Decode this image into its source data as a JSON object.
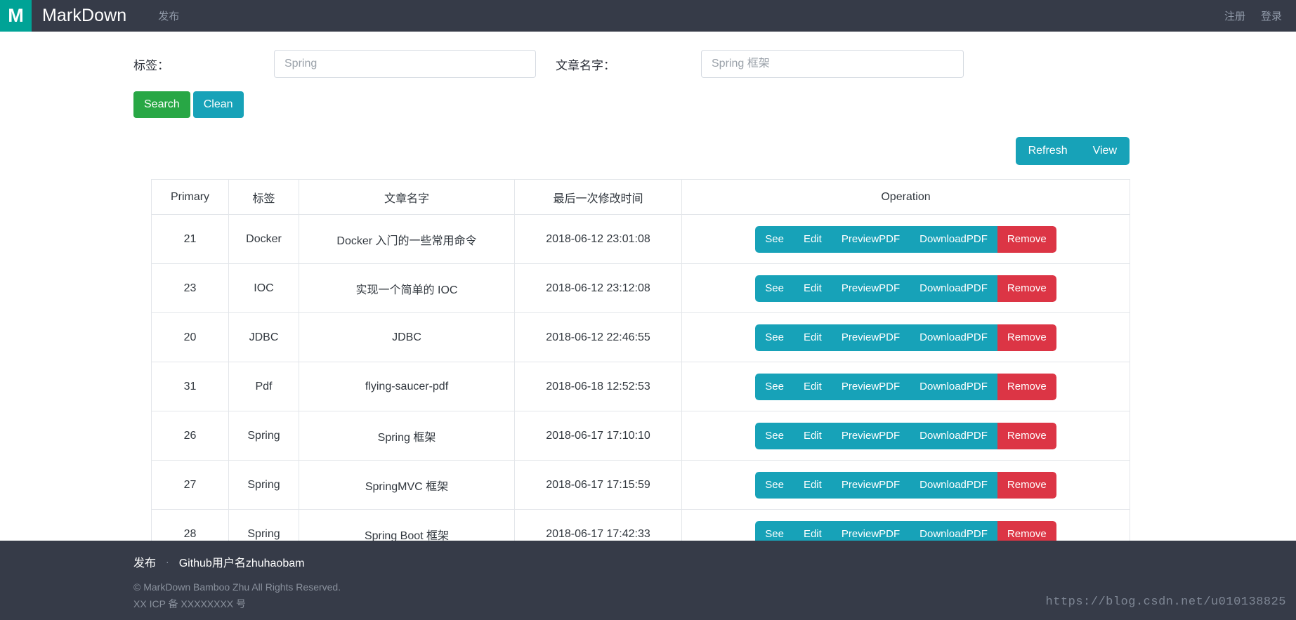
{
  "navbar": {
    "logo_letter": "M",
    "brand": "MarkDown",
    "publish_link": "发布",
    "register_link": "注册",
    "login_link": "登录"
  },
  "search": {
    "tag_label": "标签：",
    "tag_placeholder": "Spring",
    "tag_value": "",
    "title_label": "文章名字：",
    "title_placeholder": "Spring 框架",
    "title_value": "",
    "search_button": "Search",
    "clean_button": "Clean"
  },
  "toolbar": {
    "refresh_button": "Refresh",
    "view_button": "View"
  },
  "table": {
    "headers": [
      "Primary",
      "标签",
      "文章名字",
      "最后一次修改时间",
      "Operation"
    ],
    "operations": [
      "See",
      "Edit",
      "PreviewPDF",
      "DownloadPDF",
      "Remove"
    ],
    "rows": [
      {
        "primary": "21",
        "tag": "Docker",
        "title": "Docker 入门的一些常用命令",
        "modified": "2018-06-12 23:01:08"
      },
      {
        "primary": "23",
        "tag": "IOC",
        "title": "实现一个简单的 IOC",
        "modified": "2018-06-12 23:12:08"
      },
      {
        "primary": "20",
        "tag": "JDBC",
        "title": "JDBC",
        "modified": "2018-06-12 22:46:55"
      },
      {
        "primary": "31",
        "tag": "Pdf",
        "title": "flying-saucer-pdf",
        "modified": "2018-06-18 12:52:53"
      },
      {
        "primary": "26",
        "tag": "Spring",
        "title": "Spring 框架",
        "modified": "2018-06-17 17:10:10"
      },
      {
        "primary": "27",
        "tag": "Spring",
        "title": "SpringMVC 框架",
        "modified": "2018-06-17 17:15:59"
      },
      {
        "primary": "28",
        "tag": "Spring",
        "title": "Spring Boot 框架",
        "modified": "2018-06-17 17:42:33"
      },
      {
        "primary": "",
        "tag": "",
        "title": "",
        "modified": ""
      }
    ]
  },
  "footer": {
    "publish_link": "发布",
    "separator": "·",
    "github_link": "Github用户名zhuhaobam",
    "copyright": "© MarkDown Bamboo Zhu All Rights Reserved.",
    "icp": "XX ICP 备 XXXXXXXX 号"
  },
  "watermark": "https://blog.csdn.net/u010138825",
  "colors": {
    "navbar_bg": "#363b48",
    "logo_bg": "#00a396",
    "green": "#28a745",
    "teal": "#17a2b8",
    "red": "#dc3545"
  }
}
